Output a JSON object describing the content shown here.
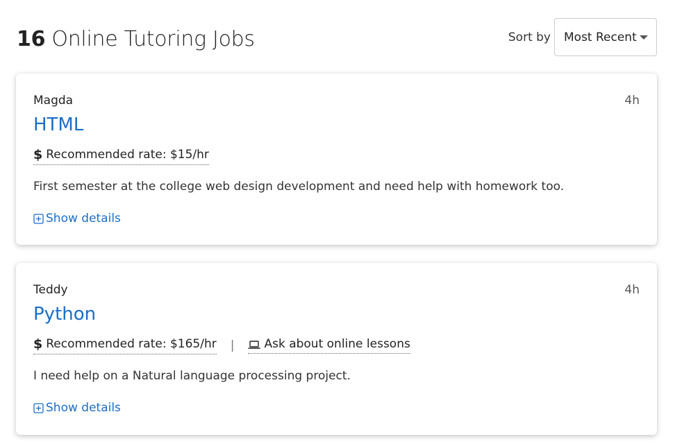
{
  "header": {
    "count": "16",
    "title": "Online Tutoring Jobs",
    "sort_label": "Sort by",
    "sort_value": "Most Recent"
  },
  "jobs": [
    {
      "student": "Magda",
      "time": "4h",
      "subject": "HTML",
      "rate": "Recommended rate: $15/hr",
      "online": "",
      "description": "First semester at the college web design development and need help with homework too.",
      "details_label": "Show details"
    },
    {
      "student": "Teddy",
      "time": "4h",
      "subject": "Python",
      "rate": "Recommended rate: $165/hr",
      "online": "Ask about online lessons",
      "description": "I need help on a Natural language processing project.",
      "details_label": "Show details"
    }
  ],
  "icons": {
    "dollar": "dollar-icon",
    "laptop": "laptop-icon",
    "plus": "plus-square-icon",
    "caret": "chevron-down-icon"
  },
  "colors": {
    "link": "#1a6ec7",
    "text": "#222222"
  }
}
